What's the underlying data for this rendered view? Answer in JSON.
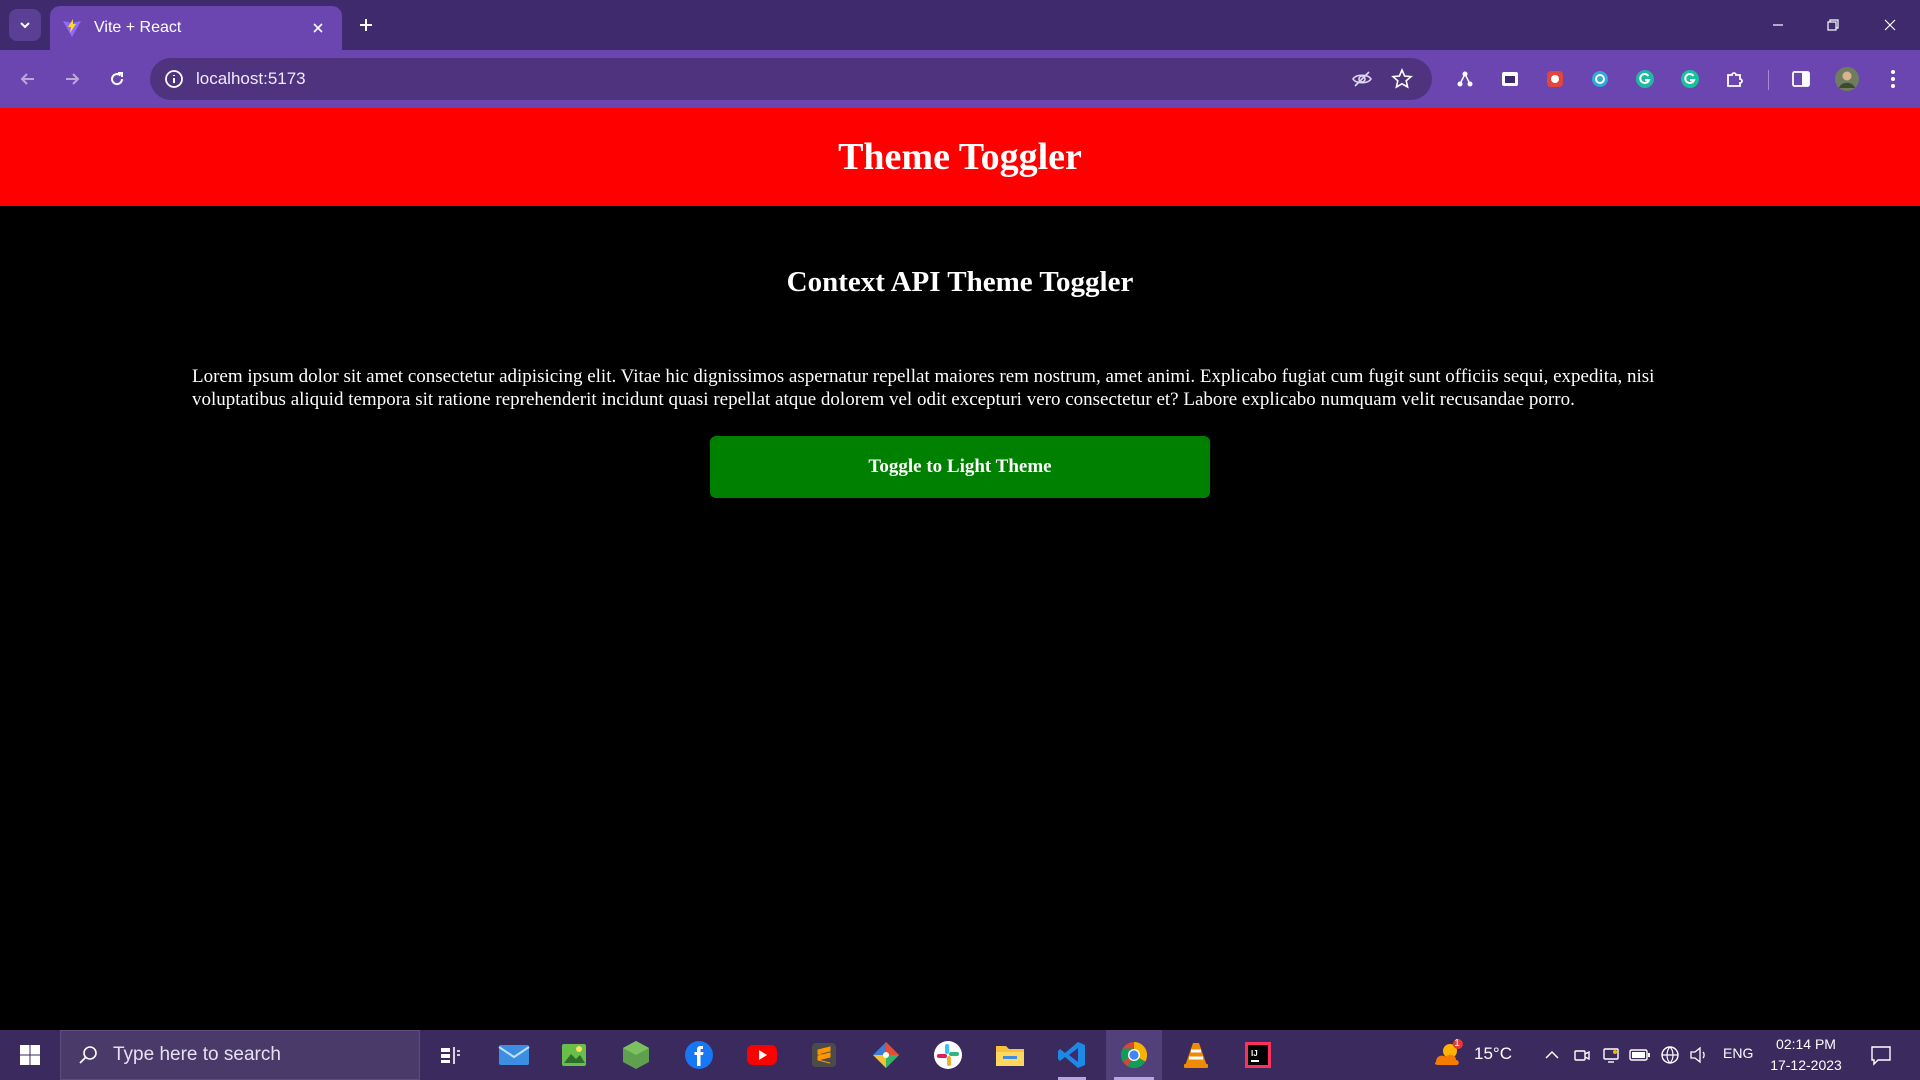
{
  "browser": {
    "tab": {
      "title": "Vite + React"
    },
    "address": {
      "url": "localhost:5173"
    }
  },
  "page": {
    "header_title": "Theme Toggler",
    "subtitle": "Context API Theme Toggler",
    "paragraph": "Lorem ipsum dolor sit amet consectetur adipisicing elit. Vitae hic dignissimos aspernatur repellat maiores rem nostrum, amet animi. Explicabo fugiat cum fugit sunt officiis sequi, expedita, nisi voluptatibus aliquid tempora sit ratione reprehenderit incidunt quasi repellat atque dolorem vel odit excepturi vero consectetur et? Labore explicabo numquam velit recusandae porro.",
    "toggle_button": "Toggle to Light Theme",
    "colors": {
      "header_bg": "#ff0000",
      "page_bg": "#000000",
      "button_bg": "#008000",
      "text": "#ffffff"
    }
  },
  "taskbar": {
    "search_placeholder": "Type here to search",
    "apps": [
      "task-view",
      "mail",
      "photos",
      "node",
      "facebook",
      "youtube",
      "sublime-text",
      "git",
      "slack",
      "file-explorer",
      "vscode",
      "chrome",
      "vlc",
      "intellij"
    ],
    "weather": {
      "temp": "15°C",
      "badge": "1"
    },
    "language": "ENG",
    "time": "02:14 PM",
    "date": "17-12-2023"
  }
}
